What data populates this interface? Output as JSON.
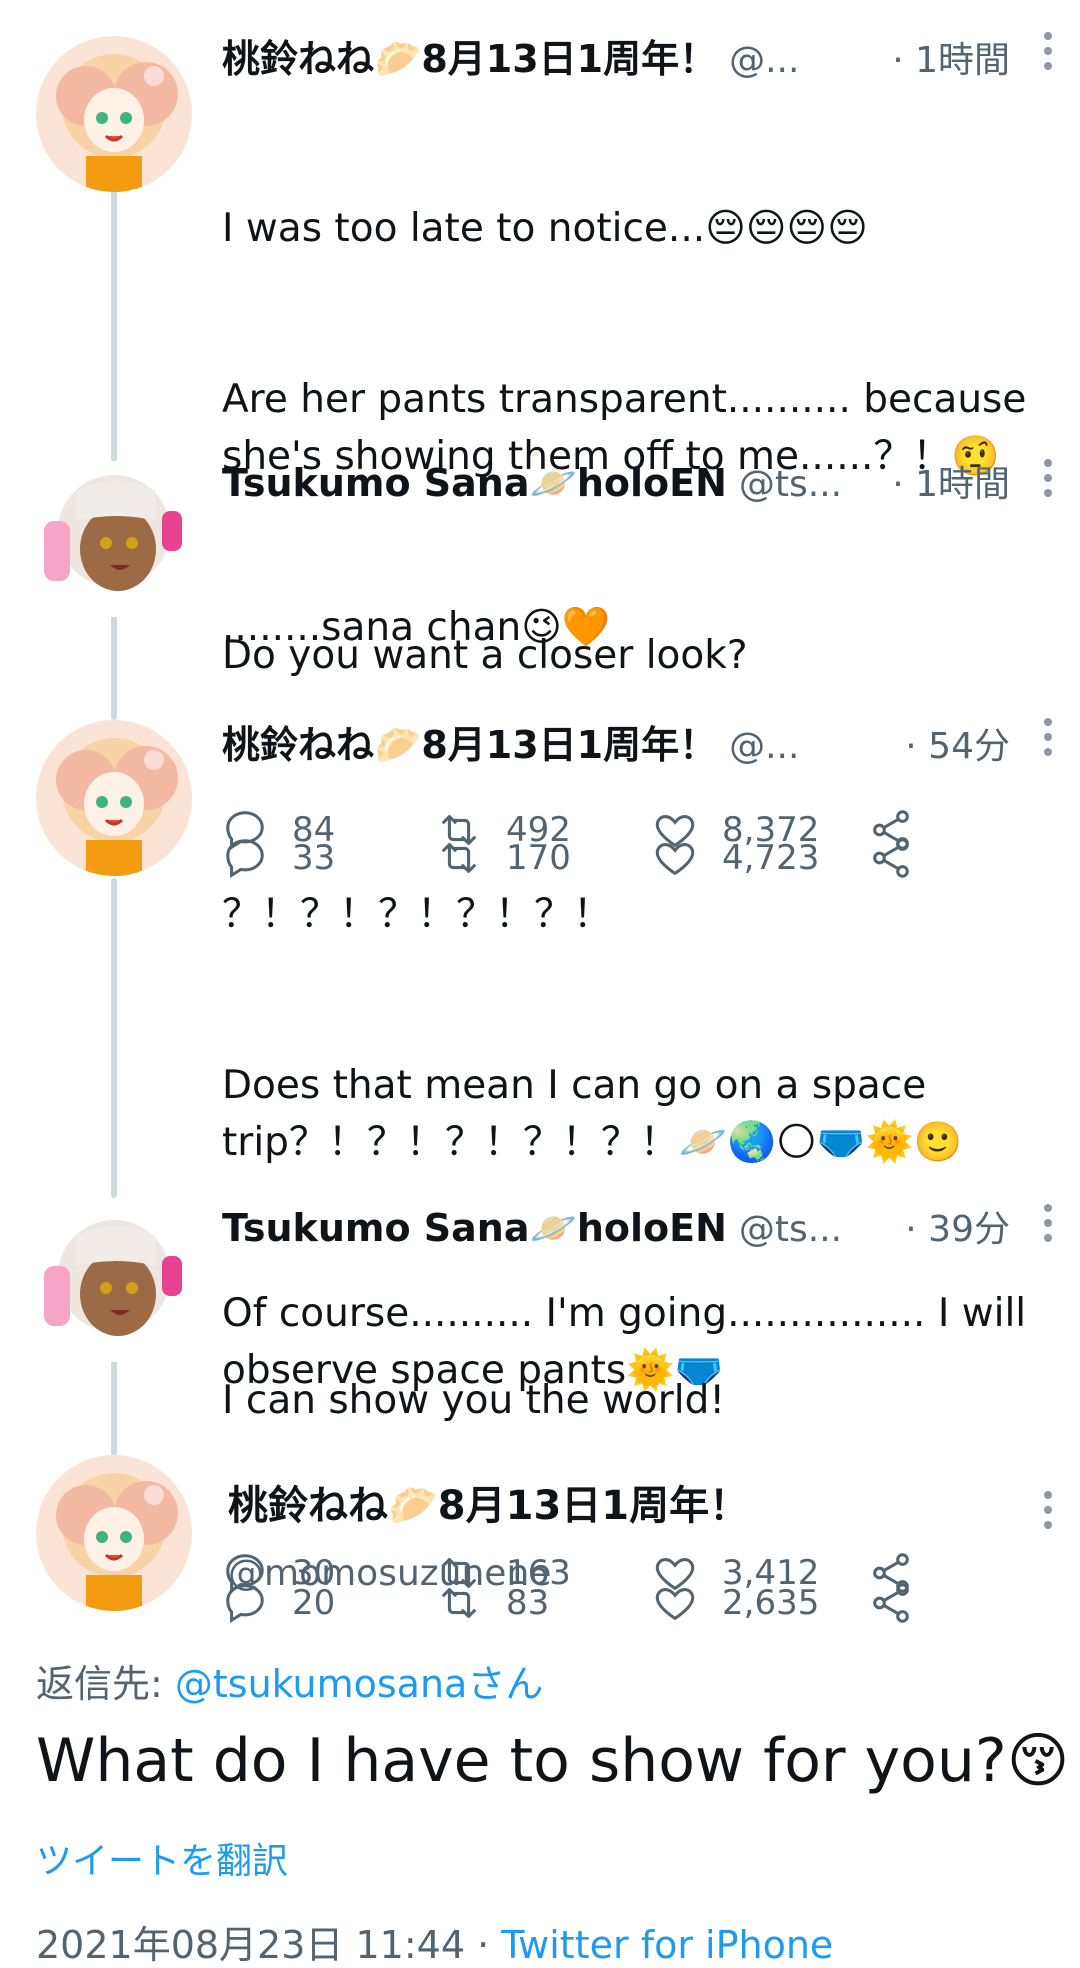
{
  "tweets": [
    {
      "name": "桃鈴ねね🥟8月13日1周年！",
      "handle": "@...",
      "time": "· 1時間",
      "lines": [
        "I was too late to notice...😔😔😔😔",
        "Are her pants transparent.......... because she's showing them off to me......？！🤨",
        "........sana chan😉🧡"
      ],
      "replies": "84",
      "retweets": "492",
      "likes": "8,372"
    },
    {
      "name": "Tsukumo Sana🪐holoEN",
      "handle": "@ts...",
      "time": "· 1時間",
      "lines": [
        "Do you want a closer look?"
      ],
      "replies": "33",
      "retweets": "170",
      "likes": "4,723"
    },
    {
      "name": "桃鈴ねね🥟8月13日1周年！",
      "handle": "@...",
      "time": "· 54分",
      "lines": [
        "？！？！？！？！？！",
        "Does that mean I can go on a space trip？！？！？！？！？！🪐🌏🌕🩲🌞🙂",
        "Of course.......... I'm going................ I will observe space pants🌞🩲"
      ],
      "replies": "30",
      "retweets": "163",
      "likes": "3,412"
    },
    {
      "name": "Tsukumo Sana🪐holoEN",
      "handle": "@ts...",
      "time": "· 39分",
      "lines": [
        "I can show you the world!"
      ],
      "replies": "20",
      "retweets": "83",
      "likes": "2,635"
    }
  ],
  "main": {
    "name": "桃鈴ねね🥟8月13日1周年！",
    "handle": "@momosuzunene",
    "reply_prefix": "返信先: ",
    "reply_to": "@tsukumosanaさん",
    "text": "What do I have to show for you?😚",
    "translate": "ツイートを翻訳",
    "datetime": "2021年08月23日 11:44 · ",
    "source": "Twitter for iPhone"
  }
}
